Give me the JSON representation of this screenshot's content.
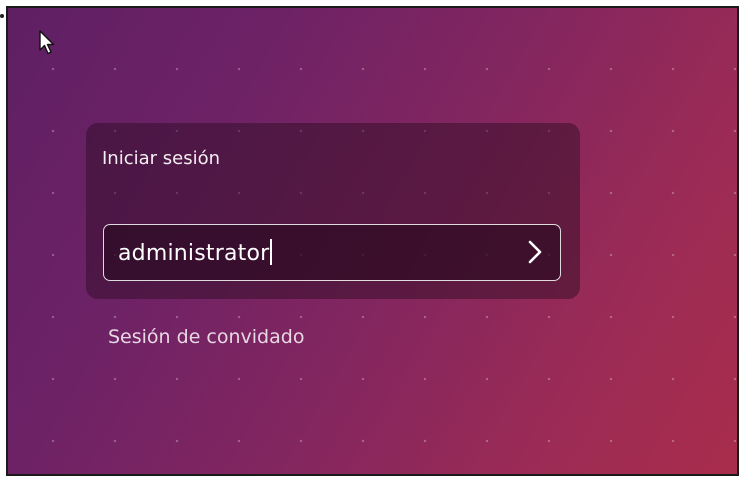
{
  "login": {
    "title": "Iniciar sesión",
    "username_value": "administrator",
    "guest_link": "Sesión de convidado"
  },
  "icons": {
    "cursor": "mouse-pointer-icon",
    "submit": "chevron-right-icon"
  },
  "colors": {
    "background_start": "#5f1f63",
    "background_end": "#a92d4c",
    "panel": "#2a0a1e",
    "text": "#ffffff"
  }
}
